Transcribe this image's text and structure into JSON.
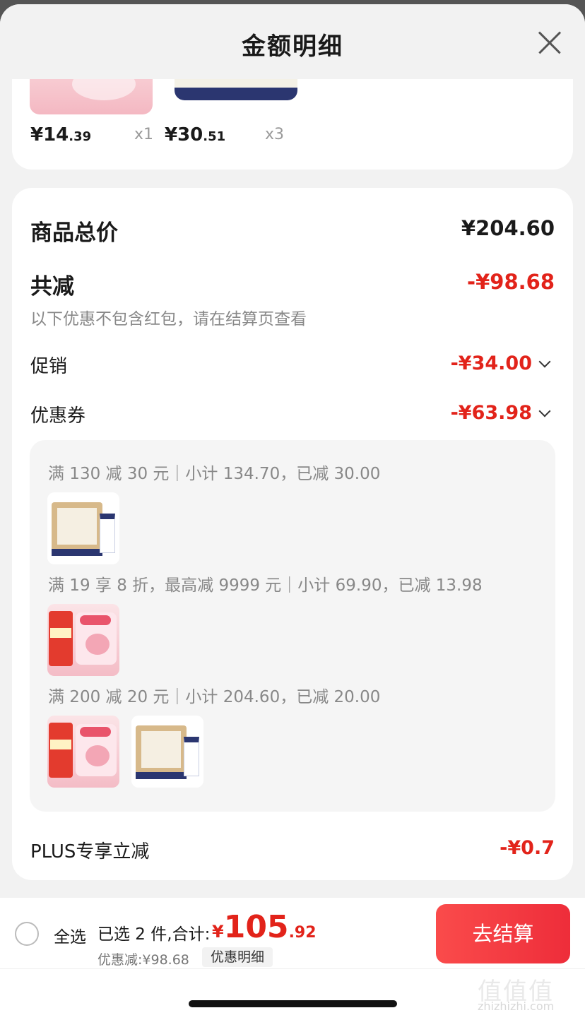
{
  "header": {
    "title": "金额明细"
  },
  "products": [
    {
      "price_int": "¥14",
      "price_dec": ".39",
      "qty": "x1"
    },
    {
      "price_int": "¥30",
      "price_dec": ".51",
      "qty": "x3"
    }
  ],
  "summary": {
    "total_label": "商品总价",
    "total_value": "¥204.60",
    "reduce_label": "共减",
    "reduce_value": "-¥98.68",
    "hint": "以下优惠不包含红包，请在结算页查看",
    "promo_label": "促销",
    "promo_value": "-¥34.00",
    "coupon_label": "优惠券",
    "coupon_value": "-¥63.98",
    "plus_label": "PLUS专享立减",
    "plus_value": "-¥0.7"
  },
  "coupons": [
    {
      "text": "满 130 减 30 元｜小计 134.70，已减 30.00",
      "items": [
        "pure-milk"
      ]
    },
    {
      "text": "满 19 享 8 折，最高减 9999 元｜小计 69.90，已减 13.98",
      "items": [
        "yogurt"
      ]
    },
    {
      "text": "满 200 减 20 元｜小计 204.60，已减 20.00",
      "items": [
        "yogurt",
        "pure-milk"
      ]
    }
  ],
  "bottom": {
    "select_all": "全选",
    "selected_info": "已选 2 件,合计:",
    "total_cur": "¥",
    "total_int": "105",
    "total_dec": ".92",
    "discount_info": "优惠减:¥98.68",
    "detail_chip": "优惠明细",
    "checkout": "去结算"
  },
  "watermark": {
    "main": "值值值",
    "sub": "zhizhizhi.com"
  },
  "colors": {
    "accent_red": "#e2231a",
    "checkout_btn": "#f23d3d"
  }
}
